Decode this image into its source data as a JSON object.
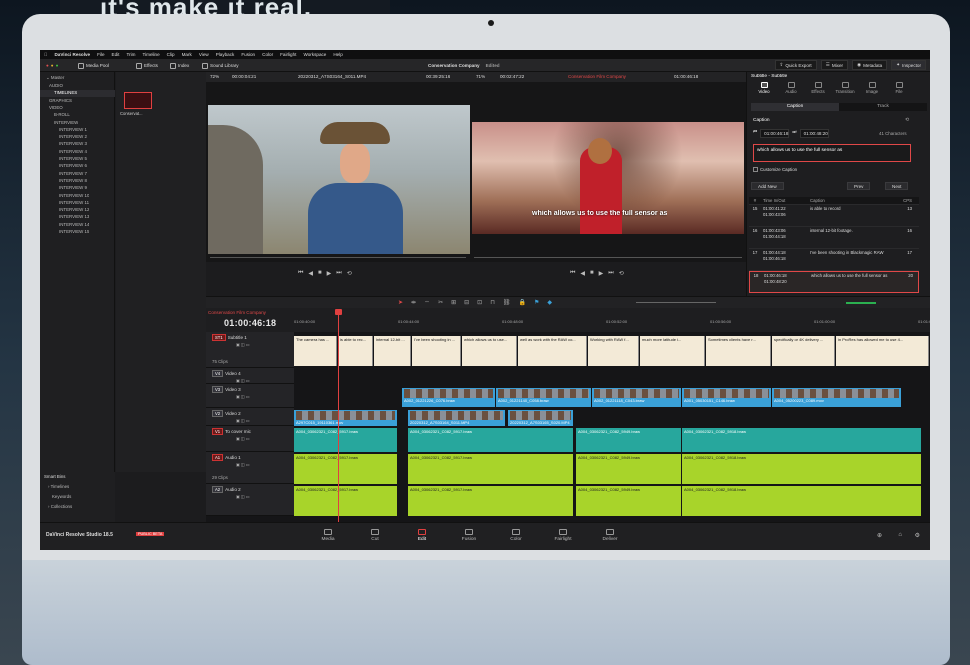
{
  "backdrop": {
    "banner_text": "it's make it real."
  },
  "menubar": {
    "app": "DaVinci Resolve",
    "items": [
      "File",
      "Edit",
      "Trim",
      "Timeline",
      "Clip",
      "Mark",
      "View",
      "Playback",
      "Fusion",
      "Color",
      "Fairlight",
      "Workspace",
      "Help"
    ],
    "window_title": "Conservation Company",
    "title_status": "Edited"
  },
  "toolbar": {
    "media_pool": "Media Pool",
    "effects": "Effects",
    "index": "Index",
    "sound_library": "Sound Library",
    "quick_export": "Quick Export",
    "mixer": "Mixer",
    "metadata": "Metadata",
    "inspector": "Inspector"
  },
  "viewer": {
    "zoom_left": "72%",
    "tc_left": "00:00:04:21",
    "clip_name": "20220312_A7S03164_S011.MP4",
    "tc_mid": "00:39:25:16",
    "zoom_right": "71%",
    "tc_right": "00:02:47:22",
    "timeline_name": "Conservation Film Company",
    "tc_prog": "01:00:46:18",
    "overlay_subtitle": "which allows us to use the full sensor as"
  },
  "bins": {
    "master": "Master",
    "items": [
      {
        "label": "AUDIO",
        "level": 1
      },
      {
        "label": "TIMELINES",
        "level": 1,
        "selected": true
      },
      {
        "label": "GRAPHICS",
        "level": 1
      },
      {
        "label": "VIDEO",
        "level": 1
      },
      {
        "label": "B-ROLL",
        "level": 2
      },
      {
        "label": "INTERVIEW",
        "level": 2
      },
      {
        "label": "INTERVIEW 1",
        "level": 3
      },
      {
        "label": "INTERVIEW 2",
        "level": 3
      },
      {
        "label": "INTERVIEW 3",
        "level": 3
      },
      {
        "label": "INTERVIEW 4",
        "level": 3
      },
      {
        "label": "INTERVIEW 5",
        "level": 3
      },
      {
        "label": "INTERVIEW 6",
        "level": 3
      },
      {
        "label": "INTERVIEW 7",
        "level": 3
      },
      {
        "label": "INTERVIEW 8",
        "level": 3
      },
      {
        "label": "INTERVIEW 9",
        "level": 3
      },
      {
        "label": "INTERVIEW 10",
        "level": 3
      },
      {
        "label": "INTERVIEW 11",
        "level": 3
      },
      {
        "label": "INTERVIEW 12",
        "level": 3
      },
      {
        "label": "INTERVIEW 13",
        "level": 3
      },
      {
        "label": "INTERVIEW 14",
        "level": 3
      },
      {
        "label": "INTERVIEW 15",
        "level": 3
      }
    ],
    "smart_bins": "Smart Bins",
    "smart_items": [
      "Timelines",
      "Keywords",
      "Collections"
    ]
  },
  "pool": {
    "thumb_label": "Conservat..."
  },
  "inspector": {
    "header": "Subtitle - Subtitle",
    "tabs": [
      "Video",
      "Audio",
      "Effects",
      "Transition",
      "Image",
      "File"
    ],
    "subtabs": [
      "Caption",
      "Track"
    ],
    "caption_label": "Caption",
    "tc_in": "01:00:46:18",
    "tc_out": "01:00:48:20",
    "char_count": "41 Characters",
    "caption_text": "which allows us to use the full sensor as",
    "customize_caption": "Customize Caption",
    "add_new": "Add New",
    "prev": "Prev",
    "next": "Next",
    "table_head": [
      "#",
      "Time In/Out",
      "Caption",
      "CPS"
    ],
    "rows": [
      {
        "n": "15",
        "in": "01:00:41:22",
        "out": "01:00:43:06",
        "text": "is able to record",
        "cps": "13"
      },
      {
        "n": "16",
        "in": "01:00:43:06",
        "out": "01:00:44:18",
        "text": "internal 12-bit footage.",
        "cps": "16"
      },
      {
        "n": "17",
        "in": "01:00:44:18",
        "out": "01:00:46:18",
        "text": "I've been shooting in Blackmagic RAW",
        "cps": "17"
      },
      {
        "n": "18",
        "in": "01:00:46:18",
        "out": "01:00:48:20",
        "text": "which allows us to use the full sensor as",
        "cps": "20",
        "selected": true
      }
    ]
  },
  "timeline": {
    "tab": "Conservation Film Company",
    "timecode": "01:00:46:18",
    "ruler": [
      "01:00:40:00",
      "01:00:44:00",
      "01:00:48:00",
      "01:00:52:00",
      "01:00:56:00",
      "01:01:00:00",
      "01:01:04:00"
    ],
    "tracks": [
      {
        "id": "ST1",
        "name": "Subtitle 1",
        "info": "75 Clips"
      },
      {
        "id": "V4",
        "name": "Video 4",
        "info": ""
      },
      {
        "id": "V3",
        "name": "Video 3",
        "info": ""
      },
      {
        "id": "V2",
        "name": "Video 2",
        "info": ""
      },
      {
        "id": "V1",
        "name": "To cover mic",
        "info": ""
      },
      {
        "id": "A1",
        "name": "Audio 1",
        "info": "29 Clips"
      },
      {
        "id": "A2",
        "name": "Audio 2",
        "info": ""
      }
    ],
    "a1_level": "2.0",
    "a2_level": "2.0",
    "subtitle_clips": [
      "The camera has ...",
      "is able to rec...",
      "internal 12-bit ...",
      "I've been shooting in ...",
      "which allows us to use...",
      "well as work with the RAW co...",
      "Working with RAW f...",
      "much more latitude i...",
      "Sometimes clients have r...",
      "specifically or 4K delivery ...",
      "in ProRes has allowed me to use 4..."
    ],
    "v3_clips": [
      "A002_01221226_C076.braw",
      "A002_01221140_C058.braw",
      "A002_01221118_C043.braw",
      "A001_05030151_C146.braw",
      "A004_05200223_C089.mov"
    ],
    "v2_clips": [
      "A297C015_19110361.mov",
      "20220312_A7S03164_S011.MP4",
      "20220312_A7S03165_S020.MP4"
    ],
    "v1_clips": [
      "A004_03062321_C082_5917.braw",
      "A004_03062321_C082_5917.braw",
      "A004_03062321_C082_5949.braw",
      "A004_03062321_C082_5918.braw"
    ],
    "a1_clips": [
      "A004_03062321_C082_5917.braw",
      "A004_03062321_C082_5917.braw",
      "A004_03062321_C082_5949.braw",
      "A004_03062321_C082_5918.braw"
    ]
  },
  "pages": {
    "brand": "DaVinci Resolve Studio 18.5",
    "beta": "PUBLIC BETA",
    "items": [
      "Media",
      "Cut",
      "Edit",
      "Fusion",
      "Color",
      "Fairlight",
      "Deliver"
    ],
    "selected": "Edit"
  }
}
